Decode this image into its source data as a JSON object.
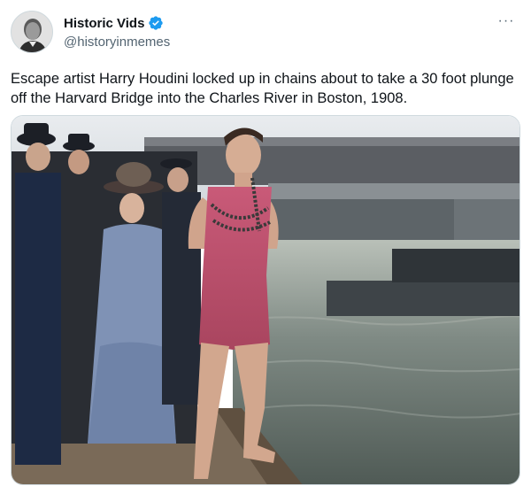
{
  "author": {
    "display_name": "Historic Vids",
    "handle": "@historyinmemes",
    "verified": true,
    "verified_color": "#1d9bf0"
  },
  "tweet": {
    "text": "Escape artist Harry Houdini locked up in chains about to take a 30 foot plunge off the Harvard Bridge into the Charles River in Boston, 1908."
  },
  "menu": {
    "more_icon": "more-horizontal-icon",
    "more_label": "···"
  },
  "media": {
    "type": "photo"
  }
}
